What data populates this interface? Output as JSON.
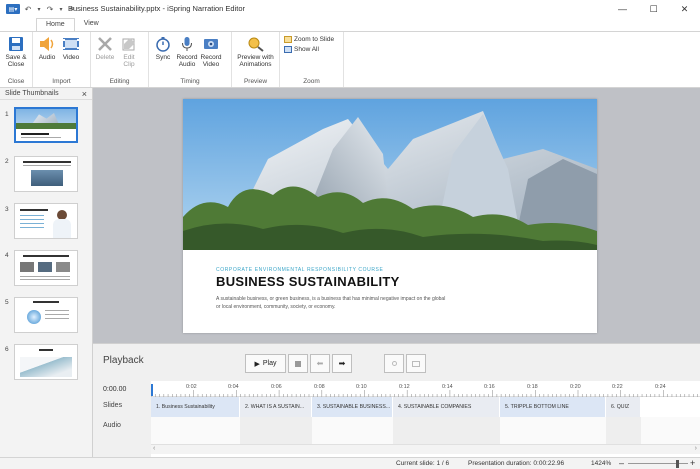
{
  "app": {
    "title": "Business Sustainability.pptx - iSpring Narration Editor",
    "app_menu_icon": "app-menu-icon",
    "accent": "#2c6fc0"
  },
  "window_controls": {
    "minimize": "—",
    "maximize": "☐",
    "close": "✕"
  },
  "tabs": [
    {
      "label": "Home",
      "active": true
    },
    {
      "label": "View",
      "active": false
    }
  ],
  "ribbon": {
    "close_group": {
      "label": "Close",
      "save_close": "Save &\nClose"
    },
    "import_group": {
      "label": "Import",
      "audio": "Audio",
      "video": "Video"
    },
    "editing_group": {
      "label": "Editing",
      "delete": "Delete",
      "edit_clip": "Edit\nClip"
    },
    "timing_group": {
      "label": "Timing",
      "sync": "Sync",
      "record_audio": "Record\nAudio",
      "record_video": "Record\nVideo"
    },
    "preview_group": {
      "label": "Preview",
      "preview": "Preview with\nAnimations"
    },
    "zoom_group": {
      "label": "Zoom",
      "zoom_to_slide": "Zoom to Slide",
      "show_all": "Show All"
    }
  },
  "slide_thumbnails": {
    "title": "Slide Thumbnails",
    "close": "×",
    "items": [
      {
        "num": "1",
        "selected": true
      },
      {
        "num": "2",
        "selected": false
      },
      {
        "num": "3",
        "selected": false
      },
      {
        "num": "4",
        "selected": false
      },
      {
        "num": "5",
        "selected": false
      },
      {
        "num": "6",
        "selected": false
      }
    ]
  },
  "slide": {
    "kicker": "CORPORATE ENVIRONMENTAL RESPONSIBILITY COURSE",
    "title": "BUSINESS SUSTAINABILITY",
    "body": "A sustainable business, or green business, is a business that has minimal negative impact on the global or local environment, community, society, or economy."
  },
  "playback": {
    "label": "Playback",
    "play": "Play"
  },
  "timeline": {
    "current_time": "0:00.00",
    "tracks": {
      "slides": "Slides",
      "audio": "Audio"
    },
    "ticks": [
      "0:02",
      "0:04",
      "0:06",
      "0:08",
      "0:10",
      "0:12",
      "0:14",
      "0:16",
      "0:18",
      "0:20",
      "0:22",
      "0:24"
    ],
    "segments": [
      {
        "label": "1. Business Sustainability"
      },
      {
        "label": "2. WHAT IS A SUSTAIN..."
      },
      {
        "label": "3. SUSTAINABLE BUSINESS..."
      },
      {
        "label": "4. SUSTAINABLE COMPANIES"
      },
      {
        "label": "5. TRIPPLE BOTTOM LINE"
      },
      {
        "label": "6. QUIZ"
      }
    ]
  },
  "status": {
    "current_slide": "Current slide: 1 / 6",
    "duration": "Presentation duration: 0:00:22.96",
    "zoom": "1424%",
    "zoom_minus": "–",
    "zoom_plus": "+"
  }
}
